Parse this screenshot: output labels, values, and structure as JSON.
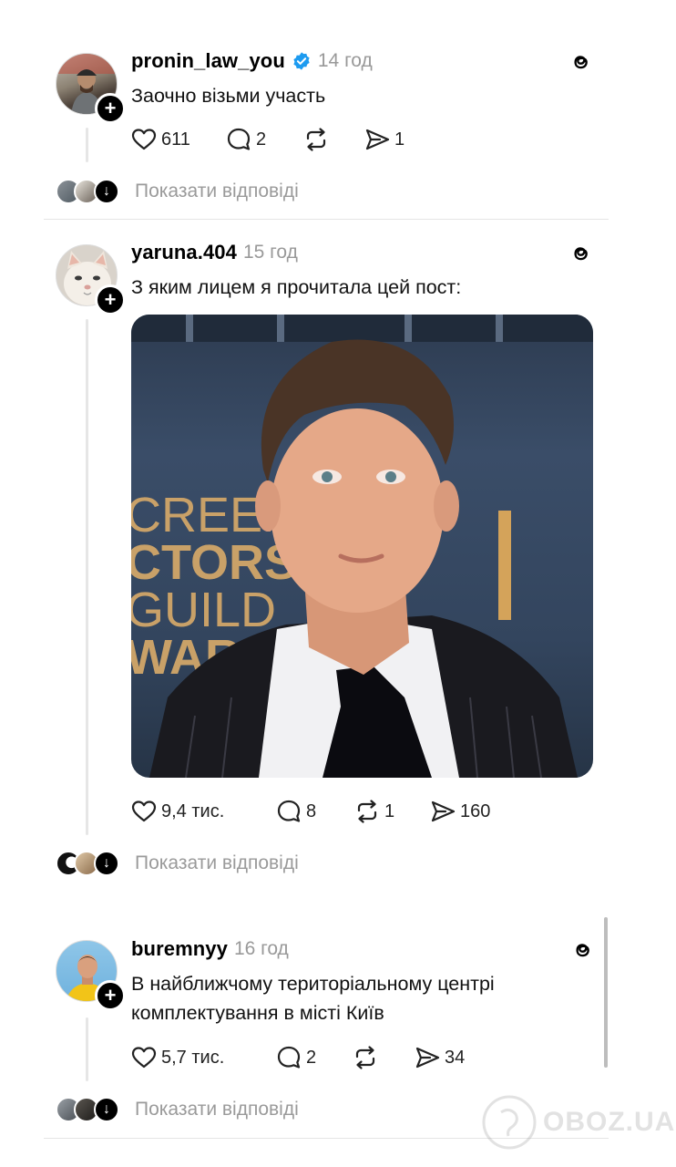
{
  "posts": [
    {
      "username": "pronin_law_you",
      "verified": true,
      "time": "14 год",
      "text": "Заочно візьми участь",
      "likes": "611",
      "comments": "2",
      "reposts": "",
      "shares": "1",
      "show_replies": "Показати відповіді"
    },
    {
      "username": "yaruna.404",
      "verified": false,
      "time": "15 год",
      "text": "З яким лицем я прочитала цей пост:",
      "image_sign": [
        "CREEN",
        "CTORS",
        "GUILD",
        "WARD"
      ],
      "likes": "9,4 тис.",
      "comments": "8",
      "reposts": "1",
      "shares": "160",
      "show_replies": "Показати відповіді"
    },
    {
      "username": "buremnyy",
      "verified": false,
      "time": "16 год",
      "text_line1": "В найближчому територіальному центрі",
      "text_line2": "комплектування в місті Київ",
      "likes": "5,7 тис.",
      "comments": "2",
      "reposts": "",
      "shares": "34",
      "show_replies": "Показати відповіді"
    }
  ],
  "watermark": "OBOZ.UA",
  "colors": {
    "verified": "#1d9bf0",
    "muted": "#9a9a9a",
    "divider": "#e5e5e5"
  }
}
